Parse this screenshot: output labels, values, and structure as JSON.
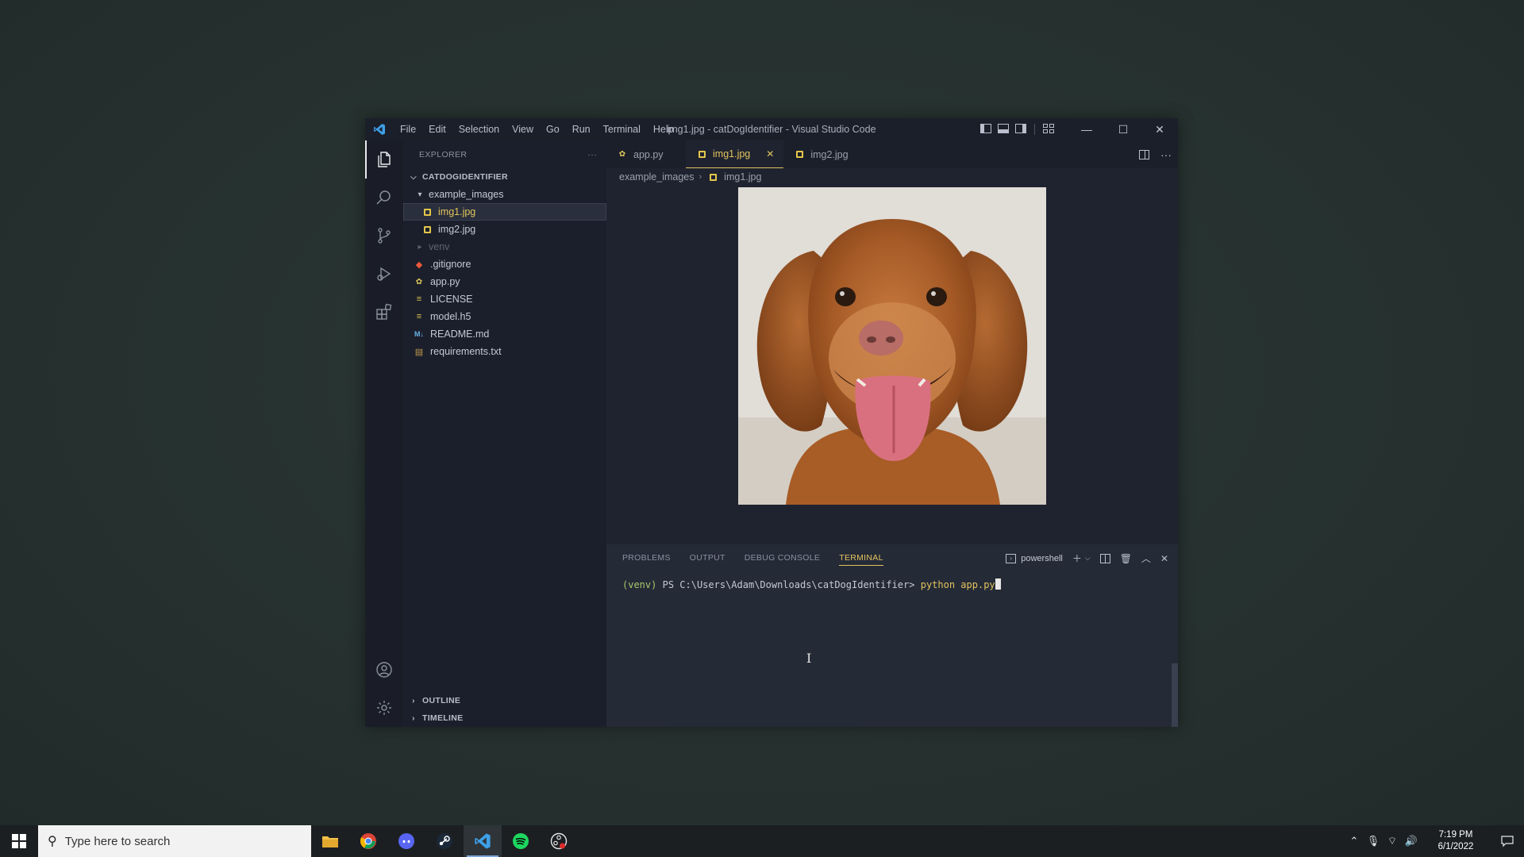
{
  "window": {
    "title": "img1.jpg - catDogIdentifier - Visual Studio Code",
    "menu": [
      "File",
      "Edit",
      "Selection",
      "View",
      "Go",
      "Run",
      "Terminal",
      "Help"
    ]
  },
  "sidebar": {
    "header": "EXPLORER",
    "project": "CATDOGIDENTIFIER",
    "folder": "example_images",
    "folder_files": [
      "img1.jpg",
      "img2.jpg"
    ],
    "venv": "venv",
    "files": [
      ".gitignore",
      "app.py",
      "LICENSE",
      "model.h5",
      "README.md",
      "requirements.txt"
    ],
    "outline": "OUTLINE",
    "timeline": "TIMELINE"
  },
  "tabs": [
    {
      "label": "app.py",
      "icon": "python-icon"
    },
    {
      "label": "img1.jpg",
      "icon": "image-icon",
      "active": true
    },
    {
      "label": "img2.jpg",
      "icon": "image-icon"
    }
  ],
  "breadcrumb": [
    "example_images",
    "img1.jpg"
  ],
  "panel": {
    "tabs": [
      "PROBLEMS",
      "OUTPUT",
      "DEBUG CONSOLE",
      "TERMINAL"
    ],
    "active_tab": "TERMINAL",
    "shell": "powershell",
    "prompt_venv": "(venv)",
    "prompt_path": "PS C:\\Users\\Adam\\Downloads\\catDogIdentifier>",
    "command": "python app.py"
  },
  "taskbar": {
    "search_placeholder": "Type here to search",
    "apps": [
      "file-explorer-icon",
      "chrome-icon",
      "discord-icon",
      "steam-icon",
      "vscode-icon",
      "spotify-icon",
      "obs-icon"
    ],
    "time": "7:19 PM",
    "date": "6/1/2022"
  },
  "colors": {
    "accent": "#e2c45d",
    "background": "#263330"
  }
}
